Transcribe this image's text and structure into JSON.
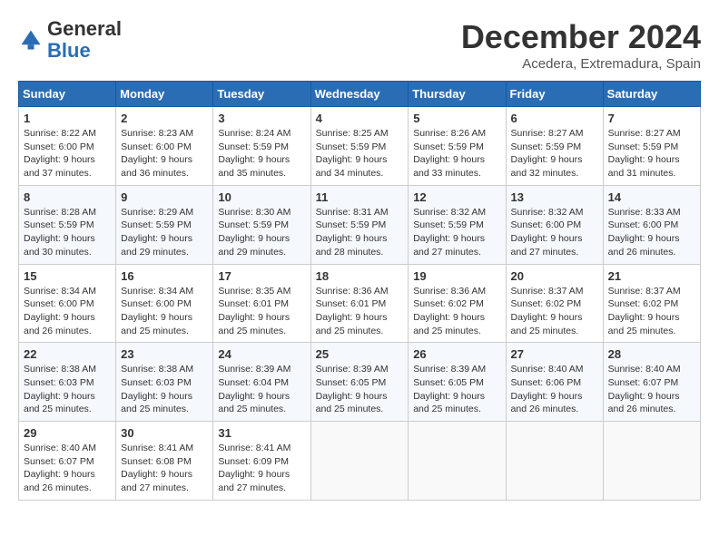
{
  "logo": {
    "general": "General",
    "blue": "Blue"
  },
  "header": {
    "month": "December 2024",
    "location": "Acedera, Extremadura, Spain"
  },
  "weekdays": [
    "Sunday",
    "Monday",
    "Tuesday",
    "Wednesday",
    "Thursday",
    "Friday",
    "Saturday"
  ],
  "weeks": [
    [
      {
        "day": "1",
        "info": "Sunrise: 8:22 AM\nSunset: 6:00 PM\nDaylight: 9 hours and 37 minutes."
      },
      {
        "day": "2",
        "info": "Sunrise: 8:23 AM\nSunset: 6:00 PM\nDaylight: 9 hours and 36 minutes."
      },
      {
        "day": "3",
        "info": "Sunrise: 8:24 AM\nSunset: 5:59 PM\nDaylight: 9 hours and 35 minutes."
      },
      {
        "day": "4",
        "info": "Sunrise: 8:25 AM\nSunset: 5:59 PM\nDaylight: 9 hours and 34 minutes."
      },
      {
        "day": "5",
        "info": "Sunrise: 8:26 AM\nSunset: 5:59 PM\nDaylight: 9 hours and 33 minutes."
      },
      {
        "day": "6",
        "info": "Sunrise: 8:27 AM\nSunset: 5:59 PM\nDaylight: 9 hours and 32 minutes."
      },
      {
        "day": "7",
        "info": "Sunrise: 8:27 AM\nSunset: 5:59 PM\nDaylight: 9 hours and 31 minutes."
      }
    ],
    [
      {
        "day": "8",
        "info": "Sunrise: 8:28 AM\nSunset: 5:59 PM\nDaylight: 9 hours and 30 minutes."
      },
      {
        "day": "9",
        "info": "Sunrise: 8:29 AM\nSunset: 5:59 PM\nDaylight: 9 hours and 29 minutes."
      },
      {
        "day": "10",
        "info": "Sunrise: 8:30 AM\nSunset: 5:59 PM\nDaylight: 9 hours and 29 minutes."
      },
      {
        "day": "11",
        "info": "Sunrise: 8:31 AM\nSunset: 5:59 PM\nDaylight: 9 hours and 28 minutes."
      },
      {
        "day": "12",
        "info": "Sunrise: 8:32 AM\nSunset: 5:59 PM\nDaylight: 9 hours and 27 minutes."
      },
      {
        "day": "13",
        "info": "Sunrise: 8:32 AM\nSunset: 6:00 PM\nDaylight: 9 hours and 27 minutes."
      },
      {
        "day": "14",
        "info": "Sunrise: 8:33 AM\nSunset: 6:00 PM\nDaylight: 9 hours and 26 minutes."
      }
    ],
    [
      {
        "day": "15",
        "info": "Sunrise: 8:34 AM\nSunset: 6:00 PM\nDaylight: 9 hours and 26 minutes."
      },
      {
        "day": "16",
        "info": "Sunrise: 8:34 AM\nSunset: 6:00 PM\nDaylight: 9 hours and 25 minutes."
      },
      {
        "day": "17",
        "info": "Sunrise: 8:35 AM\nSunset: 6:01 PM\nDaylight: 9 hours and 25 minutes."
      },
      {
        "day": "18",
        "info": "Sunrise: 8:36 AM\nSunset: 6:01 PM\nDaylight: 9 hours and 25 minutes."
      },
      {
        "day": "19",
        "info": "Sunrise: 8:36 AM\nSunset: 6:02 PM\nDaylight: 9 hours and 25 minutes."
      },
      {
        "day": "20",
        "info": "Sunrise: 8:37 AM\nSunset: 6:02 PM\nDaylight: 9 hours and 25 minutes."
      },
      {
        "day": "21",
        "info": "Sunrise: 8:37 AM\nSunset: 6:02 PM\nDaylight: 9 hours and 25 minutes."
      }
    ],
    [
      {
        "day": "22",
        "info": "Sunrise: 8:38 AM\nSunset: 6:03 PM\nDaylight: 9 hours and 25 minutes."
      },
      {
        "day": "23",
        "info": "Sunrise: 8:38 AM\nSunset: 6:03 PM\nDaylight: 9 hours and 25 minutes."
      },
      {
        "day": "24",
        "info": "Sunrise: 8:39 AM\nSunset: 6:04 PM\nDaylight: 9 hours and 25 minutes."
      },
      {
        "day": "25",
        "info": "Sunrise: 8:39 AM\nSunset: 6:05 PM\nDaylight: 9 hours and 25 minutes."
      },
      {
        "day": "26",
        "info": "Sunrise: 8:39 AM\nSunset: 6:05 PM\nDaylight: 9 hours and 25 minutes."
      },
      {
        "day": "27",
        "info": "Sunrise: 8:40 AM\nSunset: 6:06 PM\nDaylight: 9 hours and 26 minutes."
      },
      {
        "day": "28",
        "info": "Sunrise: 8:40 AM\nSunset: 6:07 PM\nDaylight: 9 hours and 26 minutes."
      }
    ],
    [
      {
        "day": "29",
        "info": "Sunrise: 8:40 AM\nSunset: 6:07 PM\nDaylight: 9 hours and 26 minutes."
      },
      {
        "day": "30",
        "info": "Sunrise: 8:41 AM\nSunset: 6:08 PM\nDaylight: 9 hours and 27 minutes."
      },
      {
        "day": "31",
        "info": "Sunrise: 8:41 AM\nSunset: 6:09 PM\nDaylight: 9 hours and 27 minutes."
      },
      null,
      null,
      null,
      null
    ]
  ]
}
